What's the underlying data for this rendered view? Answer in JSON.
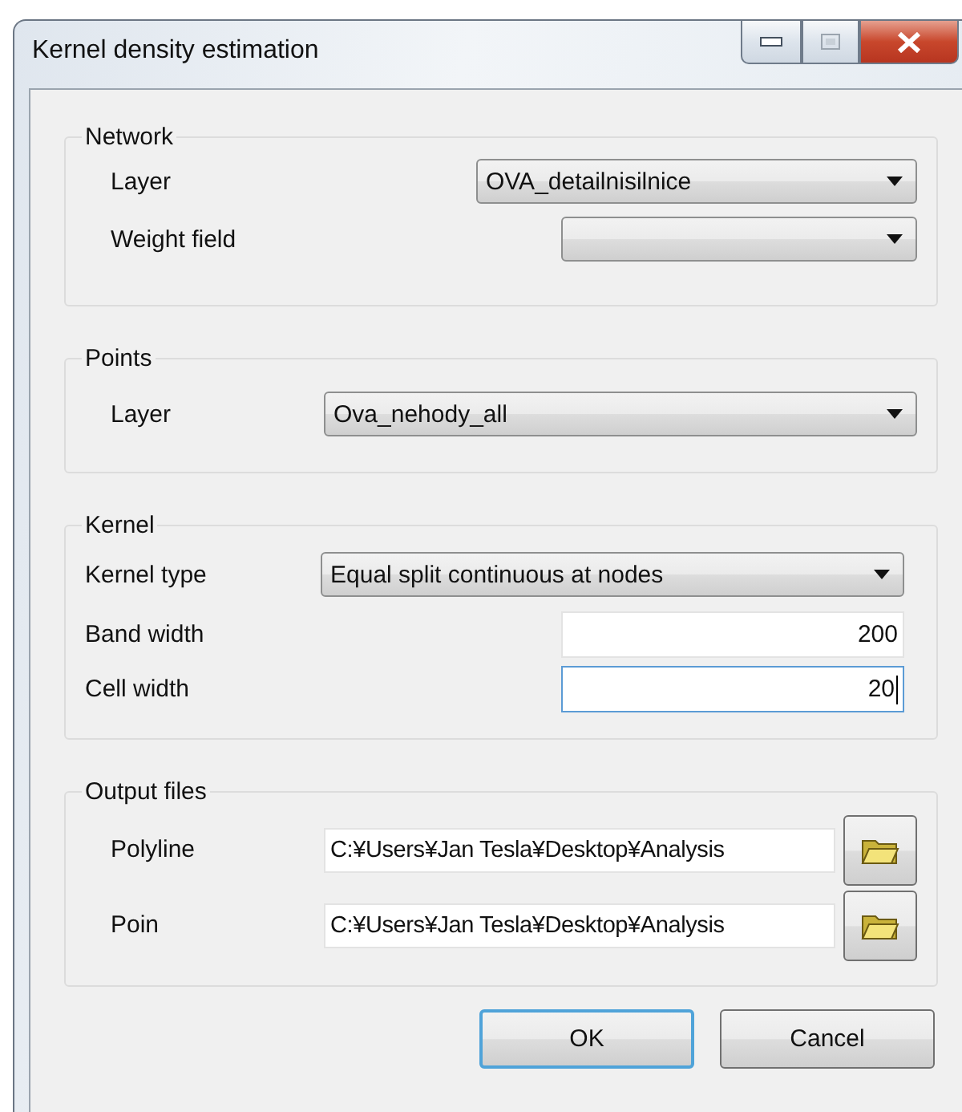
{
  "window": {
    "title": "Kernel density estimation"
  },
  "groups": [
    {
      "title": "Network",
      "rows": [
        {
          "kind": "combo",
          "label": "Layer",
          "value": "OVA_detailnisilnice"
        },
        {
          "kind": "combo",
          "label": "Weight field",
          "value": ""
        }
      ]
    },
    {
      "title": "Points",
      "rows": [
        {
          "kind": "combo",
          "label": "Layer",
          "value": "Ova_nehody_all"
        }
      ]
    },
    {
      "title": "Kernel",
      "rows": [
        {
          "kind": "combo",
          "label": "Kernel type",
          "value": "Equal split continuous at nodes"
        },
        {
          "kind": "number",
          "label": "Band width",
          "value": "200",
          "focused": false
        },
        {
          "kind": "number",
          "label": "Cell width",
          "value": "20",
          "focused": true
        }
      ]
    },
    {
      "title": "Output files",
      "rows": [
        {
          "kind": "file",
          "label": "Polyline",
          "value": "C:¥Users¥Jan Tesla¥Desktop¥Analysis"
        },
        {
          "kind": "file",
          "label": "Poin",
          "value": "C:¥Users¥Jan Tesla¥Desktop¥Analysis"
        }
      ]
    }
  ],
  "buttons": [
    {
      "label": "OK",
      "default": true
    },
    {
      "label": "Cancel",
      "default": false
    }
  ]
}
